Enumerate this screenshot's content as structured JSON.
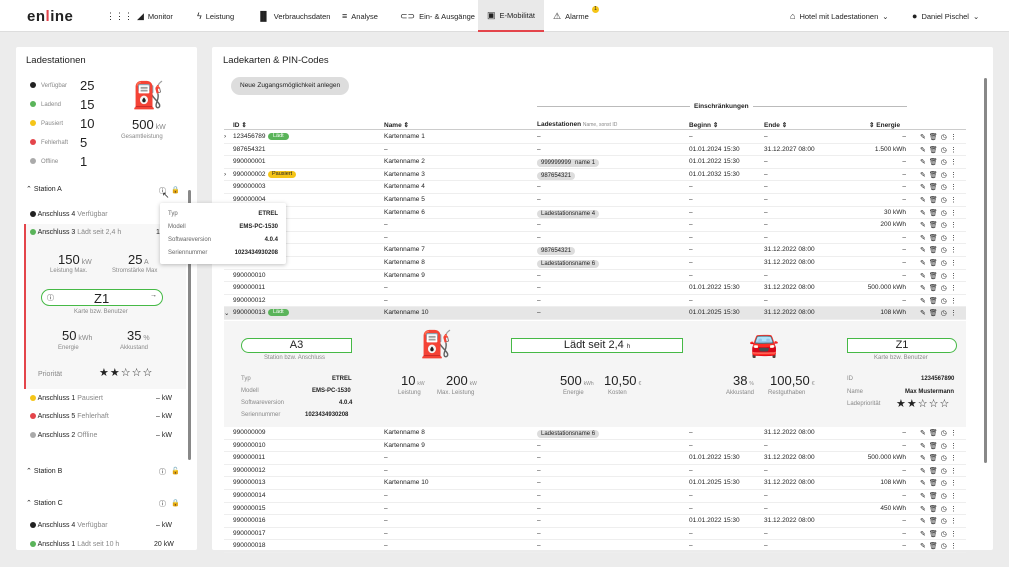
{
  "nav": {
    "logo_a": "en",
    "logo_b": "l",
    "logo_c": "ine",
    "items": [
      "Monitor",
      "Leistung",
      "Verbrauchsdaten",
      "Analyse",
      "Ein- & Ausgänge",
      "E-Mobilität",
      "Alarme"
    ],
    "alarm_count": "1",
    "hotel": "Hotel mit Ladestationen",
    "user": "Daniel Pischel"
  },
  "left": {
    "title": "Ladestationen",
    "status": [
      {
        "label": "Verfügbar",
        "count": "25",
        "color": "#222222"
      },
      {
        "label": "Ladend",
        "count": "15",
        "color": "#5ab45a"
      },
      {
        "label": "Pausiert",
        "count": "10",
        "color": "#f5c518"
      },
      {
        "label": "Fehlerhaft",
        "count": "5",
        "color": "#e4454b"
      },
      {
        "label": "Offline",
        "count": "1",
        "color": "#aaaaaa"
      }
    ],
    "total_value": "500",
    "total_unit": "kW",
    "total_label": "Gesamtleistung",
    "station_a": "Station A",
    "a4_name": "Anschluss 4",
    "a4_state": "Verfügbar",
    "a3_name": "Anschluss 3",
    "a3_state": "Lädt seit 2,4 h",
    "a3_val": "10",
    "power_max": "150",
    "power_max_unit": "kW",
    "power_max_label": "Leistung Max.",
    "current_max": "25",
    "current_max_unit": "A",
    "current_max_label": "Stromstärke Max",
    "card": "Z1",
    "card_label": "Karte bzw. Benutzer",
    "energy": "50",
    "energy_unit": "kWh",
    "energy_label": "Energie",
    "soc": "35",
    "soc_unit": "%",
    "soc_label": "Akkustand",
    "prio_label": "Priorität",
    "a1_name": "Anschluss 1",
    "a1_state": "Pausiert",
    "a1_val": "– kW",
    "a5_name": "Anschluss 5",
    "a5_state": "Fehlerhaft",
    "a5_val": "– kW",
    "a2_name": "Anschluss 2",
    "a2_state": "Offline",
    "a2_val": "– kW",
    "station_b": "Station B",
    "station_c": "Station C",
    "c4_name": "Anschluss 4",
    "c4_state": "Verfügbar",
    "c4_val": "– kW",
    "c1_name": "Anschluss 1",
    "c1_state": "Lädt seit 10 h",
    "c1_val": "20 kW"
  },
  "tooltip": {
    "typ_l": "Typ",
    "typ_v": "ETREL",
    "modell_l": "Modell",
    "modell_v": "EMS-PC-1530",
    "sw_l": "Softwareversion",
    "sw_v": "4.0.4",
    "sn_l": "Seriennummer",
    "sn_v": "1023434930208"
  },
  "main": {
    "title": "Ladekarten & PIN-Codes",
    "new_button": "Neue Zugangsmöglichkeit anlegen",
    "restrictions": "Einschränkungen",
    "headers": {
      "id": "ID",
      "name": "Name",
      "stations": "Ladestationen",
      "stations_note": "Name, sonst ID",
      "begin": "Beginn",
      "end": "Ende",
      "energy": "Energie"
    },
    "rows_top": [
      {
        "exp": "›",
        "id": "123456789",
        "chip": "Lädt",
        "chipc": "g",
        "name": "Kartenname 1",
        "st": [],
        "b": "–",
        "e": "–",
        "en": "–"
      },
      {
        "exp": "",
        "id": "987654321",
        "chip": "",
        "chipc": "",
        "name": "–",
        "st": [],
        "b": "01.01.2024 15:30",
        "e": "31.12.2027 08:00",
        "en": "1.500 kWh"
      },
      {
        "exp": "",
        "id": "990000001",
        "chip": "",
        "chipc": "",
        "name": "Kartenname 2",
        "st": [
          "Ladestationsname 1",
          "987654321",
          "999999999"
        ],
        "b": "01.01.2022 15:30",
        "e": "–",
        "en": "–"
      },
      {
        "exp": "›",
        "id": "990000002",
        "chip": "Pausiert",
        "chipc": "y",
        "name": "Kartenname 3",
        "st": [
          "987654321"
        ],
        "b": "01.01.2032 15:30",
        "e": "–",
        "en": "–"
      },
      {
        "exp": "",
        "id": "990000003",
        "chip": "",
        "chipc": "",
        "name": "Kartenname 4",
        "st": [],
        "b": "–",
        "e": "–",
        "en": "–"
      },
      {
        "exp": "",
        "id": "990000004",
        "chip": "",
        "chipc": "",
        "name": "Kartenname 5",
        "st": [],
        "b": "–",
        "e": "–",
        "en": "–"
      },
      {
        "exp": "",
        "id": "990000005",
        "chip": "",
        "chipc": "",
        "name": "Kartenname 6",
        "st": [
          "Ladestationsname 4"
        ],
        "b": "–",
        "e": "–",
        "en": "30 kWh"
      },
      {
        "exp": "",
        "id": "990000006",
        "chip": "",
        "chipc": "",
        "name": "–",
        "st": [],
        "b": "–",
        "e": "–",
        "en": "200 kWh"
      },
      {
        "exp": "",
        "id": "990000007",
        "chip": "",
        "chipc": "",
        "name": "–",
        "st": [],
        "b": "–",
        "e": "–",
        "en": "–"
      },
      {
        "exp": "",
        "id": "990000008",
        "chip": "",
        "chipc": "",
        "name": "Kartenname 7",
        "st": [
          "987654321"
        ],
        "b": "–",
        "e": "31.12.2022 08:00",
        "en": "–"
      },
      {
        "exp": "",
        "id": "990000009",
        "chip": "",
        "chipc": "",
        "name": "Kartenname 8",
        "st": [
          "Ladestationsname 6"
        ],
        "b": "–",
        "e": "31.12.2022 08:00",
        "en": "–"
      },
      {
        "exp": "",
        "id": "990000010",
        "chip": "",
        "chipc": "",
        "name": "Kartenname 9",
        "st": [],
        "b": "–",
        "e": "–",
        "en": "–"
      },
      {
        "exp": "",
        "id": "990000011",
        "chip": "",
        "chipc": "",
        "name": "–",
        "st": [],
        "b": "01.01.2022 15:30",
        "e": "31.12.2022 08:00",
        "en": "500.000 kWh"
      },
      {
        "exp": "",
        "id": "990000012",
        "chip": "",
        "chipc": "",
        "name": "–",
        "st": [],
        "b": "–",
        "e": "–",
        "en": "–"
      },
      {
        "exp": "⌄",
        "id": "990000013",
        "chip": "Lädt",
        "chipc": "g",
        "name": "Kartenname 10",
        "st": [],
        "b": "01.01.2025 15:30",
        "e": "31.12.2022 08:00",
        "en": "108 kWh"
      }
    ],
    "detail": {
      "conn": "A3",
      "conn_label": "Station bzw. Anschluss",
      "charging": "Lädt seit 2,4",
      "charging_unit": "h",
      "card": "Z1",
      "card_label": "Karte bzw. Benutzer",
      "typ_l": "Typ",
      "typ_v": "ETREL",
      "modell_l": "Modell",
      "modell_v": "EMS-PC-1530",
      "sw_l": "Softwareversion",
      "sw_v": "4.0.4",
      "sn_l": "Seriennummer",
      "sn_v": "1023434930208",
      "p": "10",
      "p_unit": "kW",
      "p_label": "Leistung",
      "pmax": "200",
      "pmax_unit": "kW",
      "pmax_label": "Max. Leistung",
      "en": "500",
      "en_unit": "kWh",
      "en_label": "Energie",
      "cost": "10,50",
      "cost_unit": "€",
      "cost_label": "Kosten",
      "soc": "38",
      "soc_unit": "%",
      "soc_label": "Akkustand",
      "credit": "100,50",
      "credit_unit": "€",
      "credit_label": "Restguthaben",
      "id_l": "ID",
      "id_v": "1234567890",
      "name_l": "Name",
      "name_v": "Max Mustermann",
      "prio_l": "Ladepriorität"
    },
    "rows_bottom": [
      {
        "exp": "",
        "id": "990000009",
        "chip": "",
        "chipc": "",
        "name": "Kartenname 8",
        "st": [
          "Ladestationsname 6"
        ],
        "b": "–",
        "e": "31.12.2022 08:00",
        "en": "–"
      },
      {
        "exp": "",
        "id": "990000010",
        "chip": "",
        "chipc": "",
        "name": "Kartenname 9",
        "st": [],
        "b": "–",
        "e": "–",
        "en": "–"
      },
      {
        "exp": "",
        "id": "990000011",
        "chip": "",
        "chipc": "",
        "name": "–",
        "st": [],
        "b": "01.01.2022 15:30",
        "e": "31.12.2022 08:00",
        "en": "500.000 kWh"
      },
      {
        "exp": "",
        "id": "990000012",
        "chip": "",
        "chipc": "",
        "name": "–",
        "st": [],
        "b": "–",
        "e": "–",
        "en": "–"
      },
      {
        "exp": "",
        "id": "990000013",
        "chip": "",
        "chipc": "",
        "name": "Kartenname 10",
        "st": [],
        "b": "01.01.2025 15:30",
        "e": "31.12.2022 08:00",
        "en": "108 kWh"
      },
      {
        "exp": "",
        "id": "990000014",
        "chip": "",
        "chipc": "",
        "name": "–",
        "st": [],
        "b": "–",
        "e": "–",
        "en": "–"
      },
      {
        "exp": "",
        "id": "990000015",
        "chip": "",
        "chipc": "",
        "name": "–",
        "st": [],
        "b": "–",
        "e": "–",
        "en": "450 kWh"
      },
      {
        "exp": "",
        "id": "990000016",
        "chip": "",
        "chipc": "",
        "name": "–",
        "st": [],
        "b": "01.01.2022 15:30",
        "e": "31.12.2022 08:00",
        "en": "–"
      },
      {
        "exp": "",
        "id": "990000017",
        "chip": "",
        "chipc": "",
        "name": "–",
        "st": [],
        "b": "–",
        "e": "–",
        "en": "–"
      },
      {
        "exp": "",
        "id": "990000018",
        "chip": "",
        "chipc": "",
        "name": "–",
        "st": [],
        "b": "–",
        "e": "–",
        "en": "–"
      }
    ]
  }
}
